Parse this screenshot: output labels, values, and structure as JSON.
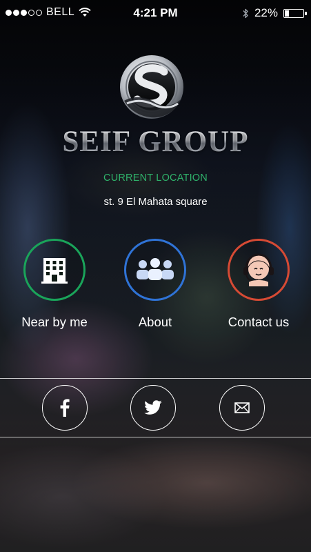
{
  "status_bar": {
    "carrier": "BELL",
    "time": "4:21 PM",
    "battery": "22%",
    "battery_level": 0.22,
    "signal_bars_filled": 3,
    "signal_bars_total": 5
  },
  "brand": {
    "name": "SEIF GROUP"
  },
  "location": {
    "label": "CURRENT LOCATION",
    "value": "st. 9 El Mahata square"
  },
  "actions": [
    {
      "label": "Near by me",
      "icon": "building-icon",
      "color": "#1aa45a"
    },
    {
      "label": "About",
      "icon": "group-icon",
      "color": "#2f73d6"
    },
    {
      "label": "Contact us",
      "icon": "support-agent-icon",
      "color": "#d64a34"
    }
  ],
  "social": [
    {
      "icon": "facebook-icon"
    },
    {
      "icon": "twitter-icon"
    },
    {
      "icon": "mail-icon"
    }
  ],
  "colors": {
    "accent_green": "#2fb36b"
  }
}
